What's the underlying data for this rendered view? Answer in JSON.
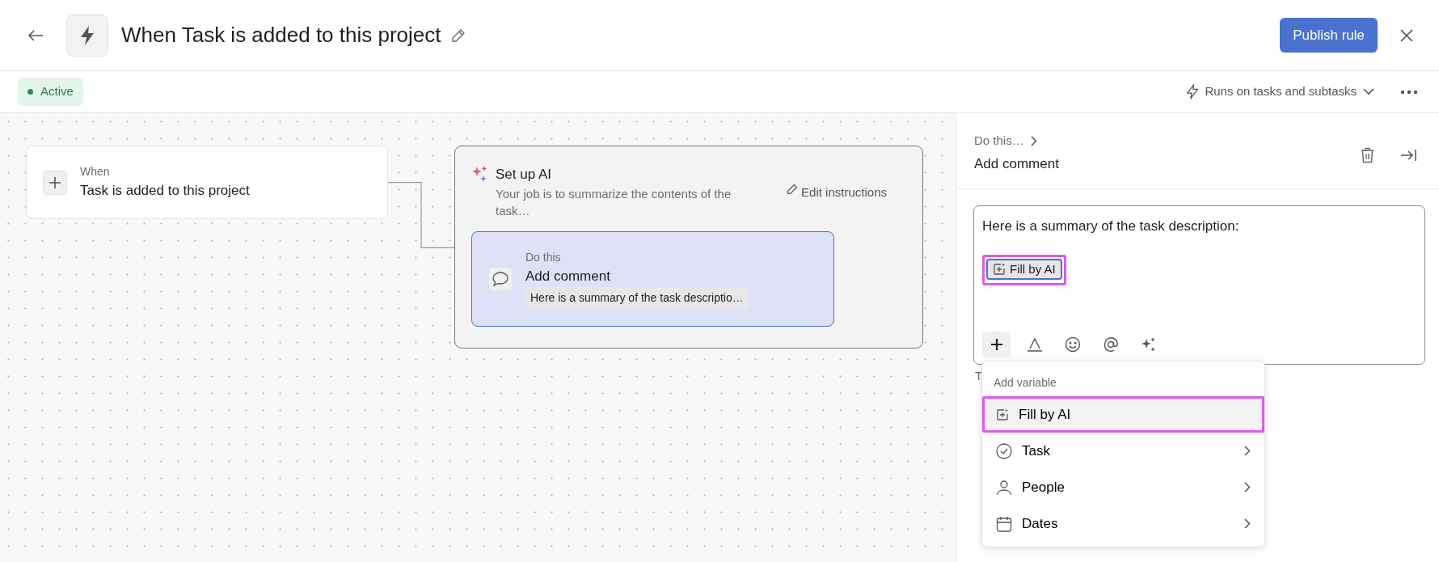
{
  "header": {
    "title": "When Task is added to this project",
    "publish_button": "Publish rule"
  },
  "status_bar": {
    "status": "Active",
    "runs_on": "Runs on tasks and subtasks"
  },
  "canvas": {
    "trigger": {
      "label": "When",
      "text": "Task is added to this project"
    },
    "ai_step": {
      "title": "Set up AI",
      "description": "Your job is to summarize the contents of the task…",
      "edit_link": "Edit instructions",
      "action": {
        "label": "Do this",
        "title": "Add comment",
        "preview": "Here is a summary of the task descriptio…",
        "selected": true
      }
    }
  },
  "panel": {
    "breadcrumb": "Do this…",
    "title": "Add comment",
    "editor": {
      "text": "Here is a summary of the task description:",
      "chip": {
        "label": "Fill by AI",
        "highlighted": true
      }
    },
    "helper_text": "T",
    "menu": {
      "heading": "Add variable",
      "items": [
        {
          "label": "Fill by AI",
          "kind": "ai",
          "selected": true
        },
        {
          "label": "Task",
          "kind": "task",
          "selected": false
        },
        {
          "label": "People",
          "kind": "people",
          "selected": false
        },
        {
          "label": "Dates",
          "kind": "dates",
          "selected": false
        }
      ]
    }
  }
}
